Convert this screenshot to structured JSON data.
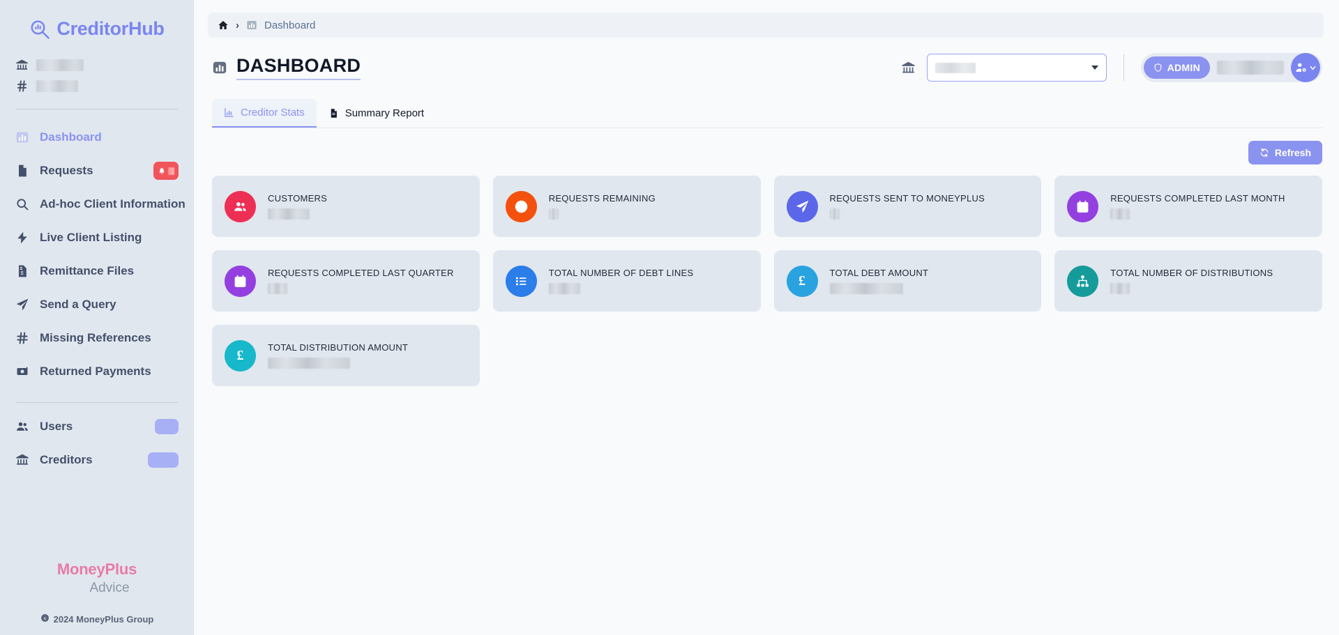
{
  "brand": {
    "name": "CreditorHub",
    "mark_icon": "magnifier-bar-chart-icon"
  },
  "sidebar": {
    "org": {
      "bank_icon": "bank-icon",
      "ref_icon": "hash-icon",
      "org_name_redacted": true,
      "org_ref_redacted": true
    },
    "items": [
      {
        "label": "Dashboard",
        "icon": "chart-bar-icon",
        "active": true,
        "badge": null
      },
      {
        "label": "Requests",
        "icon": "document-icon",
        "active": false,
        "badge": "bell-count"
      },
      {
        "label": "Ad-hoc Client Information",
        "icon": "search-icon",
        "active": false,
        "badge": null
      },
      {
        "label": "Live Client Listing",
        "icon": "bolt-icon",
        "active": false,
        "badge": null
      },
      {
        "label": "Remittance Files",
        "icon": "invoice-icon",
        "active": false,
        "badge": null
      },
      {
        "label": "Send a Query",
        "icon": "paper-plane-icon",
        "active": false,
        "badge": null
      },
      {
        "label": "Missing References",
        "icon": "hash-icon",
        "active": false,
        "badge": null
      },
      {
        "label": "Returned Payments",
        "icon": "money-return-icon",
        "active": false,
        "badge": null
      }
    ],
    "admin_items": [
      {
        "label": "Users",
        "icon": "users-icon",
        "badge_redacted": true,
        "badge_width": "small"
      },
      {
        "label": "Creditors",
        "icon": "bank-icon",
        "badge_redacted": true,
        "badge_width": "large"
      }
    ],
    "footer": {
      "brand_primary": "MoneyPlus",
      "brand_secondary": "Advice",
      "copyright": "2024 MoneyPlus Group",
      "copyright_icon": "copyright-icon"
    }
  },
  "breadcrumb": {
    "home_icon": "home-icon",
    "separator": "›",
    "page_icon": "chart-bar-icon",
    "page_label": "Dashboard"
  },
  "header": {
    "title_icon": "chart-bar-icon",
    "title": "DASHBOARD",
    "bank_icon": "bank-icon",
    "creditor_select": {
      "value_redacted": true,
      "caret_icon": "chevron-down-icon"
    },
    "user": {
      "role_badge": "ADMIN",
      "role_icon": "shield-icon",
      "name_redacted": true,
      "avatar_icon": "user-cog-icon",
      "avatar_caret_icon": "chevron-down-icon"
    }
  },
  "tabs": [
    {
      "label": "Creditor Stats",
      "icon": "chart-bar-icon",
      "active": true
    },
    {
      "label": "Summary Report",
      "icon": "document-icon",
      "active": false
    }
  ],
  "toolbar": {
    "refresh_label": "Refresh",
    "refresh_icon": "refresh-icon"
  },
  "colors": {
    "accent": "#8b93f0",
    "brand_pink": "#e87ba6",
    "badge_red": "#f2545b",
    "card_bg": "#e1e7ef",
    "sidebar_bg": "#e0e7ef"
  },
  "stat_cards": [
    {
      "label": "CUSTOMERS",
      "icon": "users-icon",
      "icon_color": "#ee2f55",
      "value_redacted": true,
      "value_width": "vw-l"
    },
    {
      "label": "REQUESTS REMAINING",
      "icon": "exclamation-circle-icon",
      "icon_color": "#f4510f",
      "value_redacted": true,
      "value_width": "vw-xs"
    },
    {
      "label": "REQUESTS SENT TO MONEYPLUS",
      "icon": "paper-plane-icon",
      "icon_color": "#5b67e8",
      "value_redacted": true,
      "value_width": "vw-xs"
    },
    {
      "label": "REQUESTS COMPLETED LAST MONTH",
      "icon": "calendar-check-icon",
      "icon_color": "#9440e0",
      "value_redacted": true,
      "value_width": "vw-s"
    },
    {
      "label": "REQUESTS COMPLETED LAST QUARTER",
      "icon": "calendar-check-icon",
      "icon_color": "#9440e0",
      "value_redacted": true,
      "value_width": "vw-s"
    },
    {
      "label": "TOTAL NUMBER OF DEBT LINES",
      "icon": "list-icon",
      "icon_color": "#2b7de9",
      "value_redacted": true,
      "value_width": "vw-m"
    },
    {
      "label": "TOTAL DEBT AMOUNT",
      "icon": "pound-icon",
      "icon_color": "#29a3e0",
      "value_redacted": true,
      "value_width": "vw-xl"
    },
    {
      "label": "TOTAL NUMBER OF DISTRIBUTIONS",
      "icon": "sitemap-icon",
      "icon_color": "#169b9b",
      "value_redacted": true,
      "value_width": "vw-s"
    },
    {
      "label": "TOTAL DISTRIBUTION AMOUNT",
      "icon": "pound-icon",
      "icon_color": "#16b8c9",
      "value_redacted": true,
      "value_width": "vw-xxl"
    }
  ]
}
